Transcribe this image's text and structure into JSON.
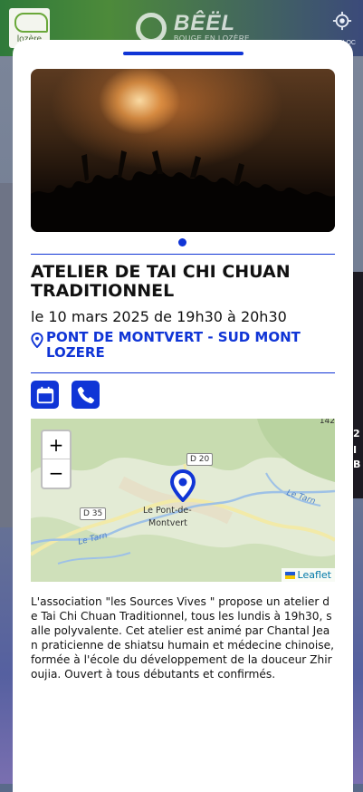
{
  "header": {
    "logo_text": "lozère",
    "brand_title": "BÊËL",
    "brand_subtitle": "BOUGE EN LOZÈRE",
    "geoloc_label": "GEOLOC",
    "geoloc_icon": "crosshair-icon"
  },
  "background": {
    "right_card_text": [
      "2",
      "I",
      "B"
    ]
  },
  "event": {
    "image_alt": "Concert crowd",
    "title": "ATELIER DE TAI CHI CHUAN TRADITIONNEL",
    "date": "le 10 mars 2025 de 19h30 à 20h30",
    "location": "PONT DE MONTVERT - SUD MONT LOZERE",
    "actions": [
      {
        "name": "calendar-icon",
        "label": "Add to calendar"
      },
      {
        "name": "phone-icon",
        "label": "Call"
      }
    ],
    "description": "L'association \"les Sources Vives \" propose un atelier de Tai Chi Chuan Traditionnel, tous les lundis à 19h30, salle polyvalente. Cet atelier est animé par Chantal Jean praticienne de shiatsu humain et médecine chinoise, formée à l'école du développement de la douceur Zhiroujia. Ouvert à tous débutants et confirmés."
  },
  "map": {
    "zoom_in": "+",
    "zoom_out": "−",
    "place_label_1": "Le Pont-de-",
    "place_label_2": "Montvert",
    "road_d20": "D 20",
    "road_d35": "D 35",
    "river_1": "Le Tarn",
    "river_2": "Le Tarn",
    "corner_number": "142",
    "attribution": "Leaflet"
  },
  "colors": {
    "accent": "#1035d6",
    "text": "#111111"
  }
}
